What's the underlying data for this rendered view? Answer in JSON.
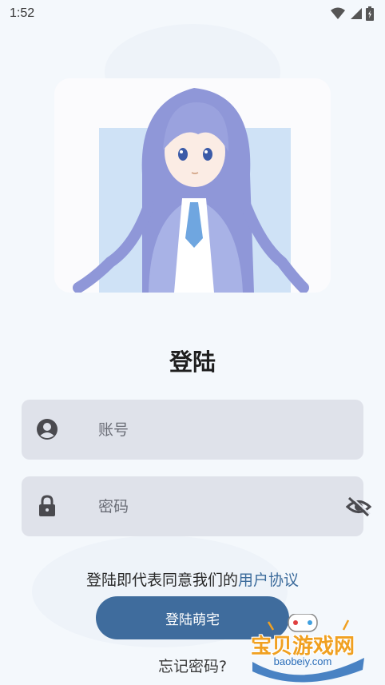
{
  "status_bar": {
    "time": "1:52"
  },
  "page": {
    "title": "登陆"
  },
  "account_field": {
    "placeholder": "账号",
    "value": ""
  },
  "password_field": {
    "placeholder": "密码",
    "value": ""
  },
  "agreement": {
    "prefix": "登陆即代表同意我们的",
    "link": "用户协议"
  },
  "login_button": {
    "label": "登陆萌宅"
  },
  "forgot": {
    "label": "忘记密码?"
  },
  "watermark": {
    "cn": "宝贝游戏网",
    "en": "baobeiy.com"
  },
  "colors": {
    "accent": "#3f6c9d",
    "field_bg": "#dfe2ea",
    "link": "#3d6c9c"
  }
}
